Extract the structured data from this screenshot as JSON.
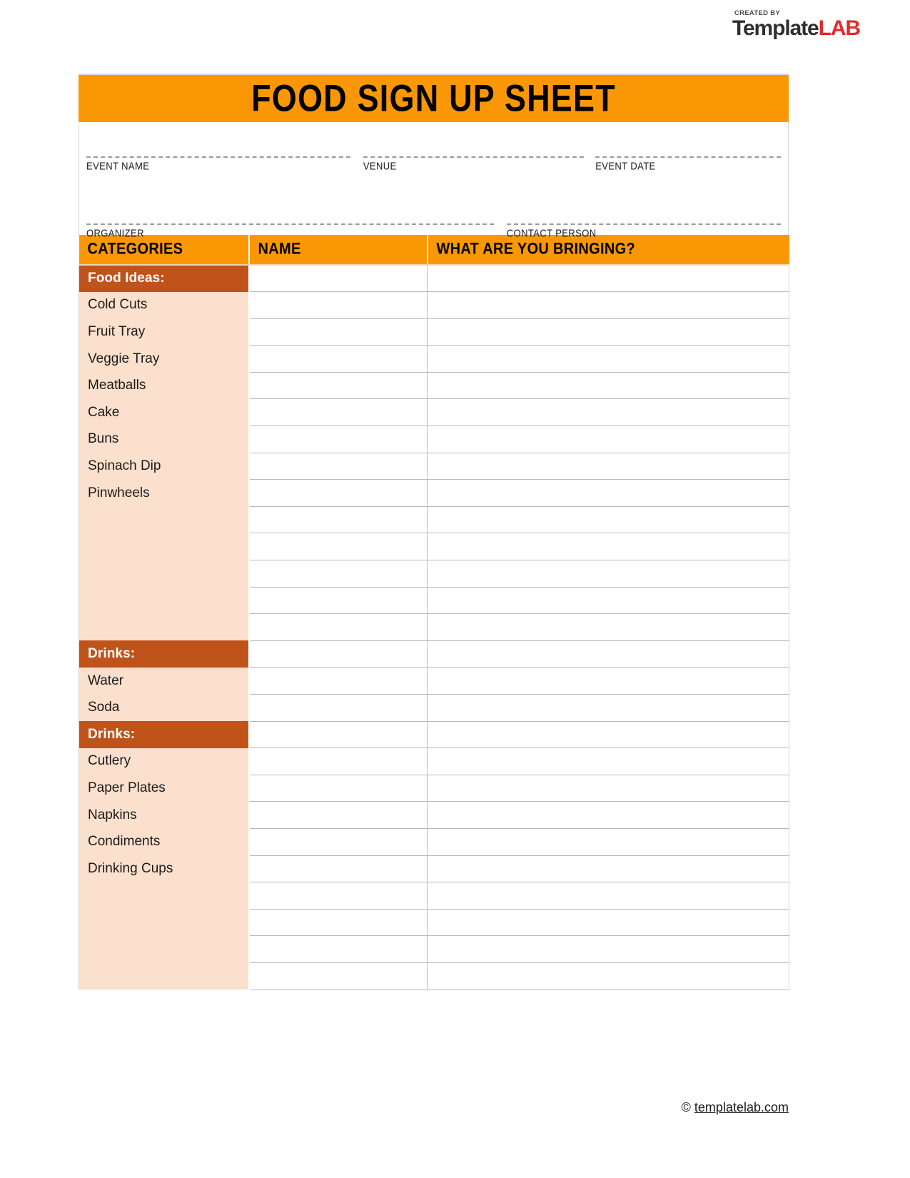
{
  "logo": {
    "created_by": "CREATED BY",
    "name_dark": "Template",
    "name_red": "LAB",
    "red": "#e02b26",
    "dark": "#2f2f2f"
  },
  "document": {
    "title": "FOOD SIGN UP SHEET",
    "accent_orange": "#FA9705",
    "section_brown": "#C0531A",
    "category_peach": "#FBE0CD"
  },
  "form_fields": {
    "row1": [
      {
        "label": "EVENT NAME",
        "value": ""
      },
      {
        "label": "VENUE",
        "value": ""
      },
      {
        "label": "EVENT DATE",
        "value": ""
      }
    ],
    "row2": [
      {
        "label": "ORGANIZER",
        "value": ""
      },
      {
        "label": "CONTACT PERSON",
        "value": ""
      }
    ]
  },
  "table": {
    "headers": {
      "categories": "CATEGORIES",
      "name": "NAME",
      "bringing": "WHAT ARE YOU BRINGING?"
    },
    "sections": [
      {
        "header": "Food Ideas:",
        "items": [
          "Cold Cuts",
          "Fruit Tray",
          "Veggie Tray",
          "Meatballs",
          "Cake",
          "Buns",
          "Spinach Dip",
          "Pinwheels"
        ],
        "blank_item_rows": 6,
        "total_rows": 14
      },
      {
        "header": "Drinks:",
        "items": [
          "Water",
          "Soda"
        ],
        "blank_item_rows": 1,
        "total_rows": 3
      },
      {
        "header": "Drinks:",
        "items": [
          "Cutlery",
          "Paper Plates",
          "Napkins",
          "Condiments",
          "Drinking Cups"
        ],
        "blank_item_rows": 5,
        "total_rows": 10
      }
    ]
  },
  "footer": {
    "copyright_symbol": "©",
    "site": "templatelab.com"
  }
}
